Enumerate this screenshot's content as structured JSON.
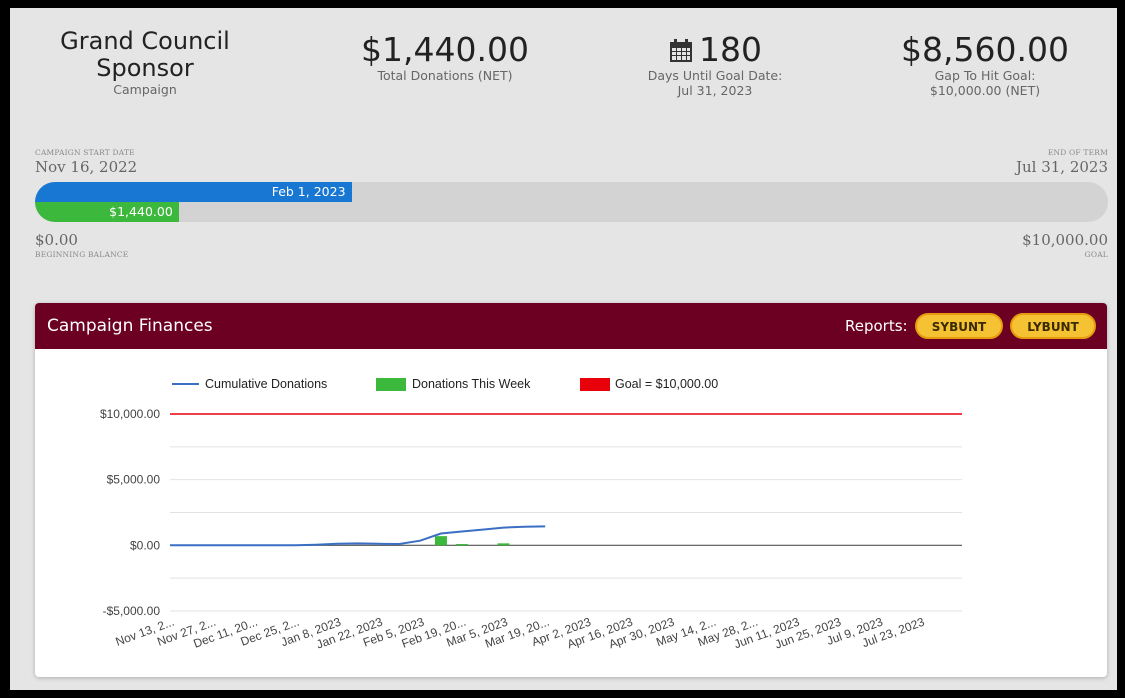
{
  "summary": {
    "campaign_name_line1": "Grand Council",
    "campaign_name_line2": "Sponsor",
    "campaign_label": "Campaign",
    "total_donations": "$1,440.00",
    "total_donations_label": "Total Donations (NET)",
    "days_until_goal": "180",
    "days_label": "Days Until Goal Date:",
    "goal_date": "Jul 31, 2023",
    "gap_to_goal": "$8,560.00",
    "gap_label": "Gap To Hit Goal:",
    "gap_goal_value": "$10,000.00 (NET)"
  },
  "timeline": {
    "start_caption": "CAMPAIGN START DATE",
    "start_date": "Nov 16, 2022",
    "end_caption": "END OF TERM",
    "end_date": "Jul 31, 2023",
    "current_date_label": "Feb 1, 2023",
    "time_progress": 0.295,
    "amount_label": "$1,440.00",
    "amount_progress": 0.134,
    "beginning_balance": "$0.00",
    "beginning_caption": "BEGINNING BALANCE",
    "goal_amount": "$10,000.00",
    "goal_caption": "GOAL"
  },
  "panel": {
    "title": "Campaign Finances",
    "reports_label": "Reports:",
    "buttons": [
      "SYBUNT",
      "LYBUNT"
    ]
  },
  "colors": {
    "header": "#6b0022",
    "cumulative": "#3a6fc4",
    "weekly": "#3cb83c",
    "goal": "#e8000b"
  },
  "chart_data": {
    "type": "line",
    "legend": [
      "Cumulative Donations",
      "Donations This Week",
      "Goal = $10,000.00"
    ],
    "y_ticks": [
      "$10,000.00",
      "$5,000.00",
      "$0.00",
      "-$5,000.00"
    ],
    "ylim": [
      -5000,
      10000
    ],
    "x": [
      "Nov 13, 2...",
      "Nov 27, 2...",
      "Dec 11, 20...",
      "Dec 25, 2...",
      "Jan 8, 2023",
      "Jan 22, 2023",
      "Feb 5, 2023",
      "Feb 19, 20...",
      "Mar 5, 2023",
      "Mar 19, 20...",
      "Apr 2, 2023",
      "Apr 16, 2023",
      "Apr 30, 2023",
      "May 14, 2...",
      "May 28, 2...",
      "Jun 11, 2023",
      "Jun 25, 2023",
      "Jul 9, 2023",
      "Jul 23, 2023"
    ],
    "weeks_total": 38,
    "series": [
      {
        "name": "Cumulative Donations",
        "type": "line",
        "values": [
          0,
          0,
          0,
          0,
          0,
          0,
          0,
          50,
          120,
          150,
          120,
          100,
          350,
          900,
          1050,
          1200,
          1350,
          1420,
          1440
        ]
      },
      {
        "name": "Donations This Week",
        "type": "bar",
        "values": [
          0,
          0,
          0,
          0,
          0,
          0,
          0,
          0,
          0,
          0,
          0,
          0,
          0,
          700,
          100,
          0,
          150,
          0,
          0
        ]
      },
      {
        "name": "Goal = $10,000.00",
        "type": "line",
        "constant": 10000
      }
    ]
  }
}
